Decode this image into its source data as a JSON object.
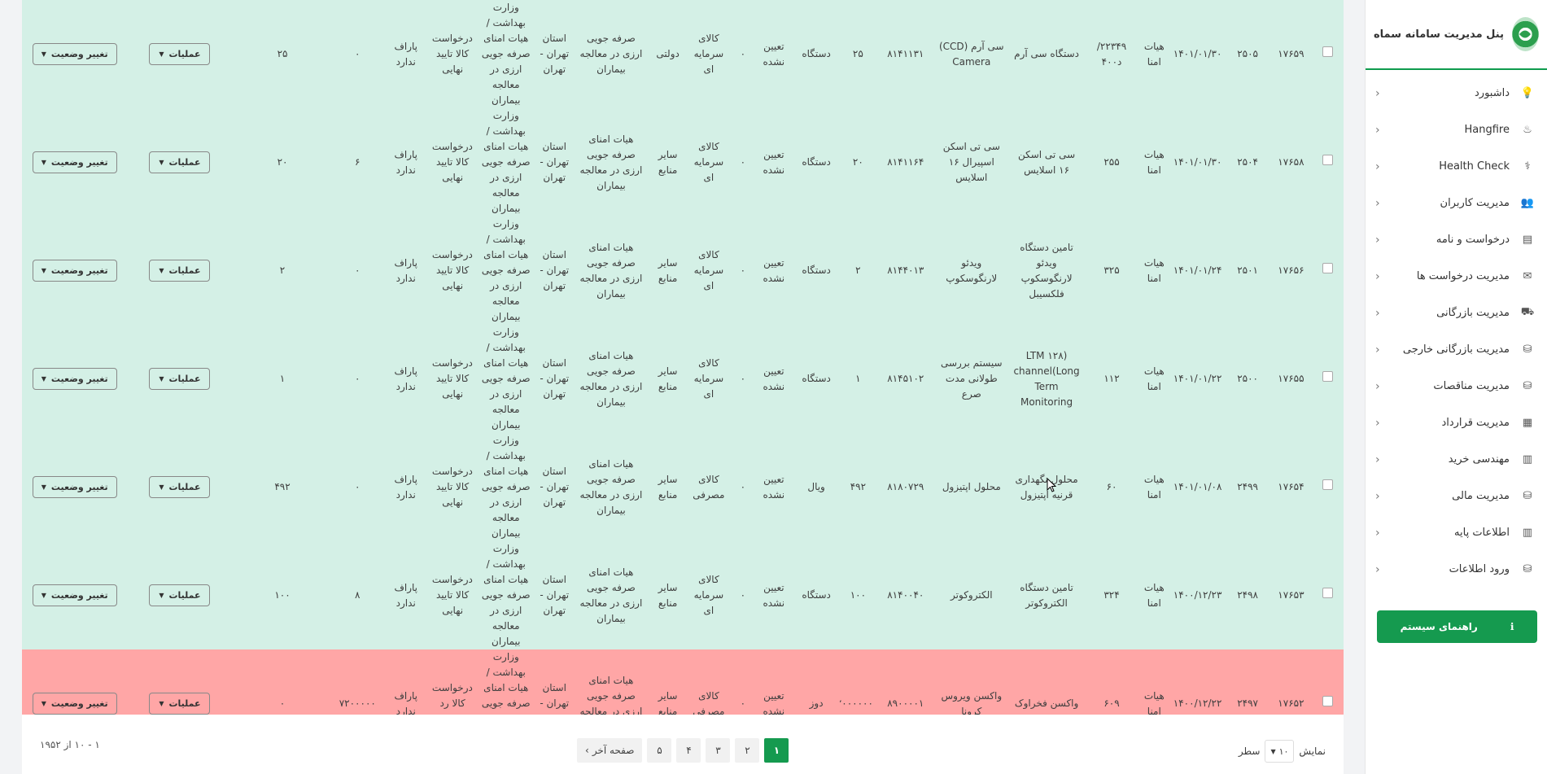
{
  "sidebar": {
    "title": "پنل مدیریت سامانه سماه",
    "items": [
      {
        "label": "داشبورد",
        "icon": "bulb-icon"
      },
      {
        "label": "Hangfire",
        "icon": "fire-icon"
      },
      {
        "label": "Health Check",
        "icon": "stethoscope-icon"
      },
      {
        "label": "مدیریت کاربران",
        "icon": "users-icon"
      },
      {
        "label": "درخواست و نامه",
        "icon": "archive-icon"
      },
      {
        "label": "مدیریت درخواست ها",
        "icon": "scroll-icon"
      },
      {
        "label": "مدیریت بازرگانی",
        "icon": "truck-icon"
      },
      {
        "label": "مدیریت بازرگانی خارجی",
        "icon": "database-icon"
      },
      {
        "label": "مدیریت مناقصات",
        "icon": "database-icon"
      },
      {
        "label": "مدیریت قرارداد",
        "icon": "file-icon"
      },
      {
        "label": "مهندسی خرید",
        "icon": "building-icon"
      },
      {
        "label": "مدیریت مالی",
        "icon": "database-icon"
      },
      {
        "label": "اطلاعات پایه",
        "icon": "building-icon"
      },
      {
        "label": "ورود اطلاعات",
        "icon": "database-icon"
      }
    ],
    "help_label": "راهنمای سیستم"
  },
  "buttons": {
    "ops_label": "عملیات",
    "status_label": "تغییر وضعیت"
  },
  "rows": [
    {
      "id": "۱۷۶۵۹",
      "no": "۲۵۰۵",
      "date": "۱۴۰۱/۰۱/۳۰",
      "board": "هیات امنا",
      "code": "۲۲۳۴۹/د۴۰۰",
      "title": "دستگاه سی آرم",
      "item": "سی آرم (CCD) Camera",
      "catalog": "۸۱۴۱۱۳۱",
      "qty": "۲۵",
      "unit": "دستگاه",
      "supplier": "تعیین نشده",
      "amount": "۰",
      "type": "کالای سرمایه ای",
      "source": "دولتی",
      "fund": "صرفه جویی ارزی در معالجه بیماران",
      "province": "استان تهران - تهران",
      "board2": "وزارت بهداشت / هیات امنای صرفه جویی ارزی در معالجه بیماران",
      "status": "درخواست کالا تایید نهایی",
      "paraf": "پاراف ندارد",
      "approved": "۰",
      "remain": "۲۵",
      "color": "green"
    },
    {
      "id": "۱۷۶۵۸",
      "no": "۲۵۰۴",
      "date": "۱۴۰۱/۰۱/۳۰",
      "board": "هیات امنا",
      "code": "۲۵۵",
      "title": "سی تی اسکن ۱۶ اسلایس",
      "item": "سی تی اسکن اسپیرال ۱۶ اسلایس",
      "catalog": "۸۱۴۱۱۶۴",
      "qty": "۲۰",
      "unit": "دستگاه",
      "supplier": "تعیین نشده",
      "amount": "۰",
      "type": "کالای سرمایه ای",
      "source": "سایر منابع",
      "fund": "هیات امنای صرفه جویی ارزی در معالجه بیماران",
      "province": "استان تهران - تهران",
      "board2": "وزارت بهداشت / هیات امنای صرفه جویی ارزی در معالجه بیماران",
      "status": "درخواست کالا تایید نهایی",
      "paraf": "پاراف ندارد",
      "approved": "۶",
      "remain": "۲۰",
      "color": "green"
    },
    {
      "id": "۱۷۶۵۶",
      "no": "۲۵۰۱",
      "date": "۱۴۰۱/۰۱/۲۴",
      "board": "هیات امنا",
      "code": "۳۲۵",
      "title": "تامین دستگاه ویدئو لارنگوسکوپ فلکسیبل",
      "item": "ویدئو لارنگوسکوپ",
      "catalog": "۸۱۴۴۰۱۳",
      "qty": "۲",
      "unit": "دستگاه",
      "supplier": "تعیین نشده",
      "amount": "۰",
      "type": "کالای سرمایه ای",
      "source": "سایر منابع",
      "fund": "هیات امنای صرفه جویی ارزی در معالجه بیماران",
      "province": "استان تهران - تهران",
      "board2": "وزارت بهداشت / هیات امنای صرفه جویی ارزی در معالجه بیماران",
      "status": "درخواست کالا تایید نهایی",
      "paraf": "پاراف ندارد",
      "approved": "۰",
      "remain": "۲",
      "color": "green"
    },
    {
      "id": "۱۷۶۵۵",
      "no": "۲۵۰۰",
      "date": "۱۴۰۱/۰۱/۲۲",
      "board": "هیات امنا",
      "code": "۱۱۲",
      "title": "LTM ۱۲۸) channel(Long Term Monitoring",
      "item": "سیستم بررسی طولانی مدت صرع",
      "catalog": "۸۱۴۵۱۰۲",
      "qty": "۱",
      "unit": "دستگاه",
      "supplier": "تعیین نشده",
      "amount": "۰",
      "type": "کالای سرمایه ای",
      "source": "سایر منابع",
      "fund": "هیات امنای صرفه جویی ارزی در معالجه بیماران",
      "province": "استان تهران - تهران",
      "board2": "وزارت بهداشت / هیات امنای صرفه جویی ارزی در معالجه بیماران",
      "status": "درخواست کالا تایید نهایی",
      "paraf": "پاراف ندارد",
      "approved": "۰",
      "remain": "۱",
      "color": "green"
    },
    {
      "id": "۱۷۶۵۴",
      "no": "۲۴۹۹",
      "date": "۱۴۰۱/۰۱/۰۸",
      "board": "هیات امنا",
      "code": "۶۰",
      "title": "محلول نگهداری قرنیه اپتیزول",
      "item": "محلول اپتیزول",
      "catalog": "۸۱۸۰۷۲۹",
      "qty": "۴۹۲",
      "unit": "ویال",
      "supplier": "تعیین نشده",
      "amount": "۰",
      "type": "کالای مصرفی",
      "source": "سایر منابع",
      "fund": "هیات امنای صرفه جویی ارزی در معالجه بیماران",
      "province": "استان تهران - تهران",
      "board2": "وزارت بهداشت / هیات امنای صرفه جویی ارزی در معالجه بیماران",
      "status": "درخواست کالا تایید نهایی",
      "paraf": "پاراف ندارد",
      "approved": "۰",
      "remain": "۴۹۲",
      "color": "green"
    },
    {
      "id": "۱۷۶۵۳",
      "no": "۲۴۹۸",
      "date": "۱۴۰۰/۱۲/۲۳",
      "board": "هیات امنا",
      "code": "۳۲۴",
      "title": "تامین دستگاه الکتروکوتر",
      "item": "الکتروکوتر",
      "catalog": "۸۱۴۰۰۴۰",
      "qty": "۱۰۰",
      "unit": "دستگاه",
      "supplier": "تعیین نشده",
      "amount": "۰",
      "type": "کالای سرمایه ای",
      "source": "سایر منابع",
      "fund": "هیات امنای صرفه جویی ارزی در معالجه بیماران",
      "province": "استان تهران - تهران",
      "board2": "وزارت بهداشت / هیات امنای صرفه جویی ارزی در معالجه بیماران",
      "status": "درخواست کالا تایید نهایی",
      "paraf": "پاراف ندارد",
      "approved": "۸",
      "remain": "۱۰۰",
      "color": "green"
    },
    {
      "id": "۱۷۶۵۲",
      "no": "۲۴۹۷",
      "date": "۱۴۰۰/۱۲/۲۲",
      "board": "هیات امنا",
      "code": "۶۰۹",
      "title": "واکسن فخراوک",
      "item": "واکسن ویروس کرونا",
      "catalog": "۸۹۰۰۰۰۱",
      "qty": "۲۰۰۰۰۰۰",
      "unit": "دوز",
      "supplier": "تعیین نشده",
      "amount": "۰",
      "type": "کالای مصرفی",
      "source": "سایر منابع",
      "fund": "هیات امنای صرفه جویی ارزی در معالجه بیماران",
      "province": "استان تهران - تهران",
      "board2": "وزارت بهداشت / هیات امنای صرفه جویی ارزی در معالجه بیماران",
      "status": "درخواست کالا رد شده",
      "paraf": "پاراف ندارد",
      "approved": "۷۲۰۰۰۰۰",
      "remain": "۰",
      "color": "red"
    }
  ],
  "footer": {
    "show_label": "نمایش",
    "rows_value": "۱۰",
    "rows_suffix": "سطر",
    "pages": [
      "۱",
      "۲",
      "۳",
      "۴",
      "۵"
    ],
    "last_page_label": "صفحه آخر",
    "range_text": "۱ - ۱۰ از ۱۹۵۲"
  }
}
